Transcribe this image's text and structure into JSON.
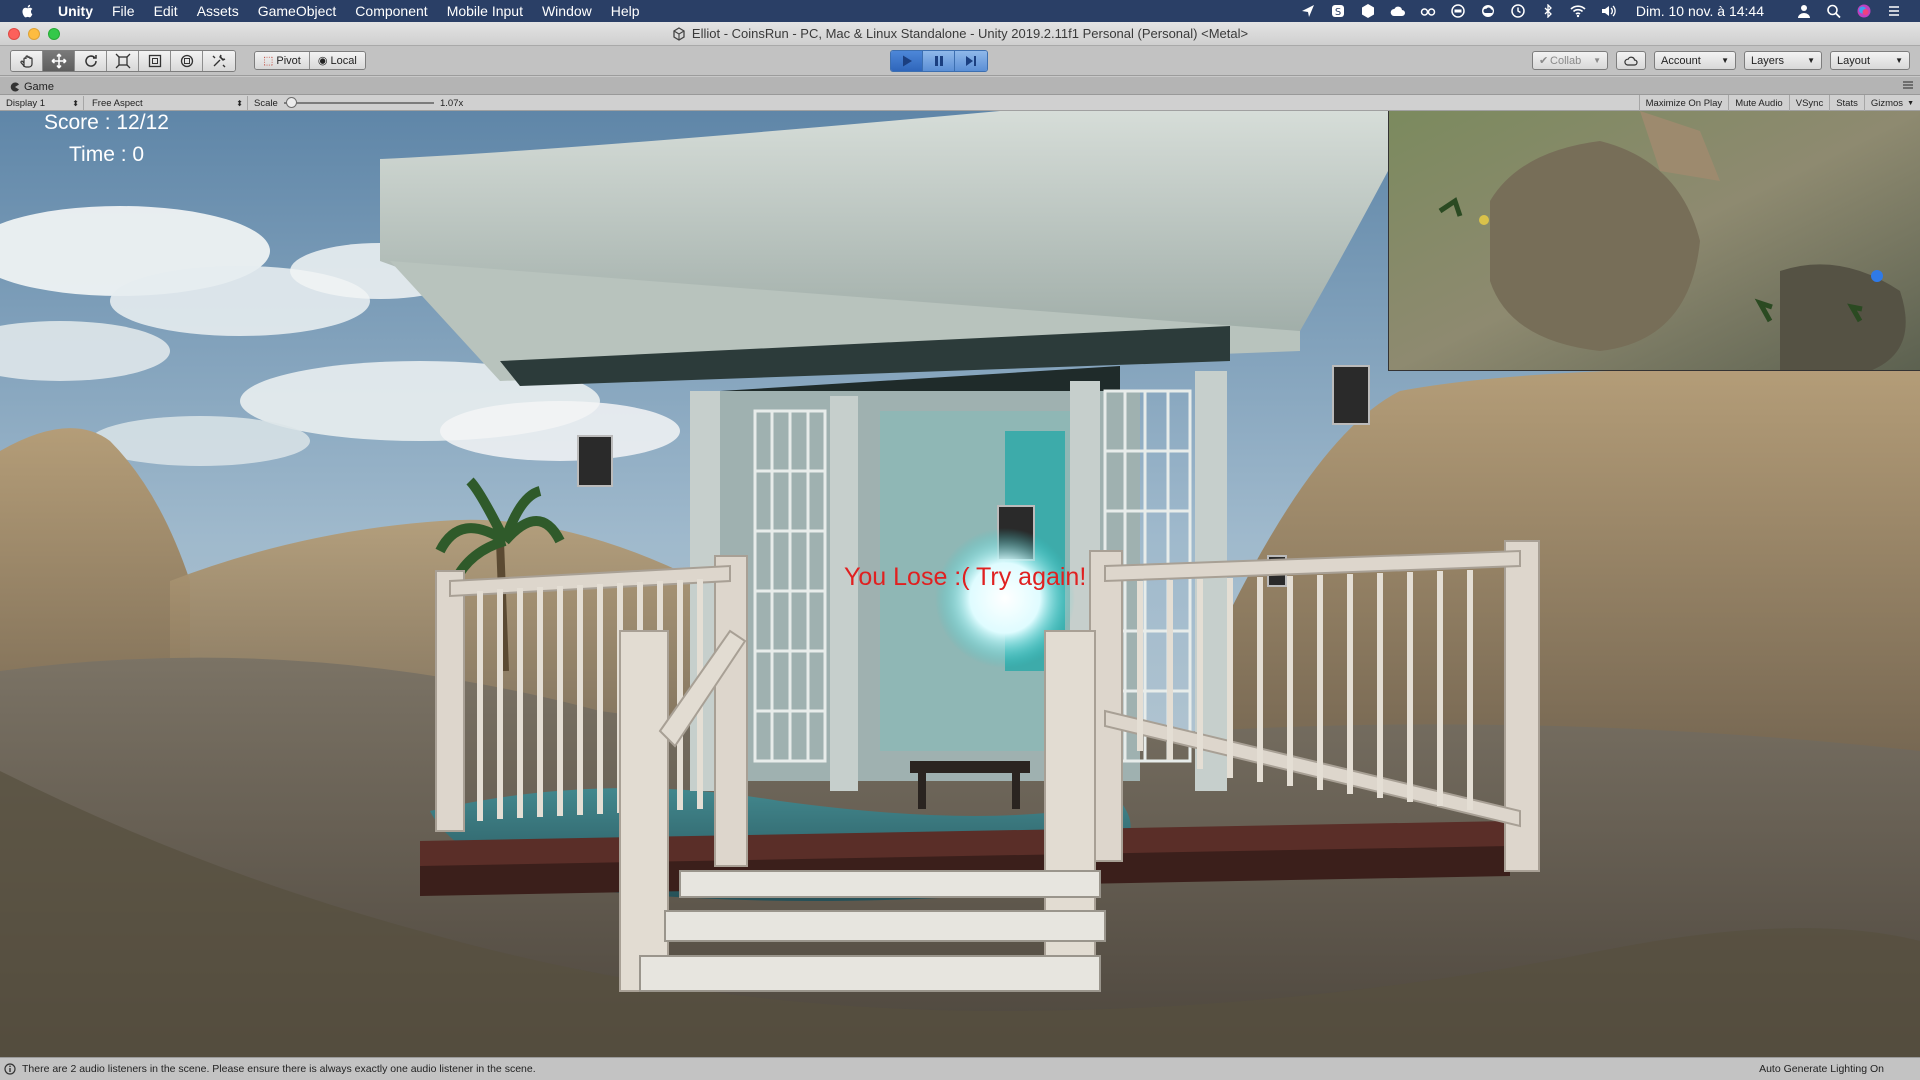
{
  "menubar": {
    "app": "Unity",
    "items": [
      "File",
      "Edit",
      "Assets",
      "GameObject",
      "Component",
      "Mobile Input",
      "Window",
      "Help"
    ],
    "clock": "Dim. 10 nov. à 14:44"
  },
  "window": {
    "title": "Elliot - CoinsRun - PC, Mac & Linux Standalone - Unity 2019.2.11f1 Personal (Personal) <Metal>"
  },
  "toolbar": {
    "pivot_label": "Pivot",
    "local_label": "Local",
    "collab_label": "Collab",
    "account_label": "Account",
    "layers_label": "Layers",
    "layout_label": "Layout"
  },
  "game_tab": {
    "label": "Game"
  },
  "game_toolbar": {
    "display": "Display 1",
    "aspect": "Free Aspect",
    "scale_label": "Scale",
    "scale_value": "1.07x",
    "maximize": "Maximize On Play",
    "mute": "Mute Audio",
    "vsync": "VSync",
    "stats": "Stats",
    "gizmos": "Gizmos"
  },
  "hud": {
    "score": "Score : 12/12",
    "time": "Time : 0",
    "message": "You Lose :( Try again!"
  },
  "statusbar": {
    "message": "There are 2 audio listeners in the scene. Please ensure there is always exactly one audio listener in the scene.",
    "lighting": "Auto Generate Lighting On"
  },
  "colors": {
    "menubar": "#2a3f66",
    "play_active": "#2f66bb",
    "lose_text": "#e02020"
  }
}
